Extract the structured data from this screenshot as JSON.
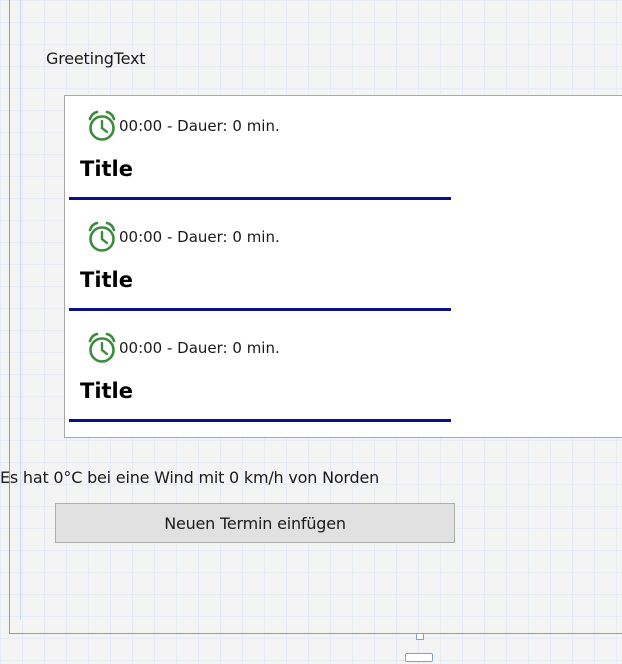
{
  "greeting_text": "GreetingText",
  "appointments": [
    {
      "time_info": "00:00 - Dauer: 0 min.",
      "title": "Title"
    },
    {
      "time_info": "00:00 - Dauer: 0 min.",
      "title": "Title"
    },
    {
      "time_info": "00:00 - Dauer: 0 min.",
      "title": "Title"
    }
  ],
  "weather_text": "Es hat 0°C bei eine Wind mit 0 km/h von Norden",
  "add_button_label": "Neuen Termin einfügen",
  "icons": {
    "appointment_icon": "alarm-clock-icon"
  },
  "colors": {
    "underline": "#0a1088",
    "clock_icon": "#3c8a3c",
    "designer_border": "#7da2ce"
  }
}
